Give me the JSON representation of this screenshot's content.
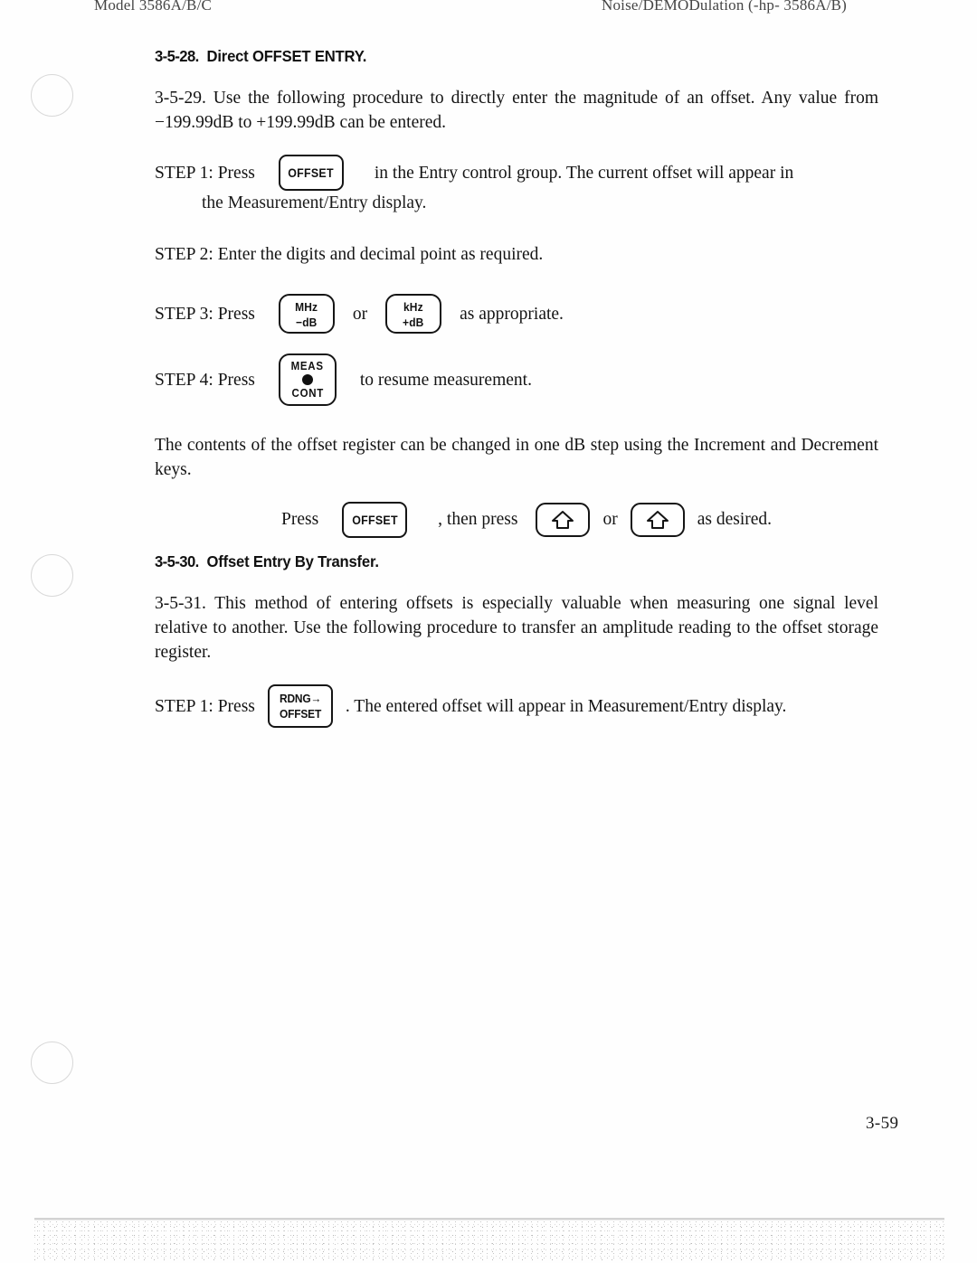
{
  "header": {
    "left": "Model 3586A/B/C",
    "right": "Noise/DEMODulation (-hp- 3586A/B)"
  },
  "sections": [
    {
      "id": "3-5-28",
      "number": "3-5-28.",
      "title": "Direct OFFSET ENTRY."
    },
    {
      "id": "3-5-30",
      "number": "3-5-30.",
      "title": "Offset Entry By Transfer."
    }
  ],
  "paragraphs": {
    "p_3_5_29": "3-5-29.  Use the following procedure to directly enter the magnitude of an offset. Any value from −199.99dB to +199.99dB can be entered.",
    "p_offset_register": "The contents of the offset register can be changed in one dB step using the Increment and Decrement keys.",
    "p_3_5_31": "3-5-31.  This method of entering offsets is especially valuable when measuring one signal level relative to another. Use the following procedure to transfer an amplitude reading to the offset storage register."
  },
  "steps": {
    "step1a": {
      "lead": "STEP 1:  Press",
      "tail": "in the Entry control group. The current offset will appear in",
      "sub": "the Measurement/Entry display."
    },
    "step2": {
      "text": "STEP 2:  Enter the digits and decimal point as required."
    },
    "step3": {
      "lead": "STEP 3:  Press",
      "mid": "or",
      "tail": "as appropriate."
    },
    "step4": {
      "lead": "STEP 4:  Press",
      "tail": "to resume measurement."
    },
    "press_line": {
      "lead": "Press",
      "mid_after_offset": ", then press",
      "mid_or": "or",
      "tail": "as desired."
    },
    "step1b": {
      "lead": "STEP 1:  Press",
      "tail": ". The entered offset will appear in Measurement/Entry display."
    }
  },
  "keys": {
    "offset": {
      "label": "OFFSET",
      "name": "offset-key"
    },
    "mhz_minus_db": {
      "line1": "MHz",
      "line2": "−dB",
      "name": "mhz-minus-db-key"
    },
    "khz_plus_db": {
      "line1": "kHz",
      "line2": "+dB",
      "name": "khz-plus-db-key"
    },
    "meas_cont": {
      "line1": "MEAS",
      "line2": "CONT",
      "name": "meas-cont-key"
    },
    "increment": {
      "glyph": "up-arrow",
      "name": "increment-key"
    },
    "decrement": {
      "glyph": "up-arrow",
      "name": "decrement-key"
    },
    "rdng_offset": {
      "line1": "RDNG→",
      "line2": "OFFSET",
      "name": "rdng-to-offset-key"
    }
  },
  "footer": {
    "page_number": "3-59"
  },
  "colors": {
    "ink": "#141414",
    "paper": "#fefefe",
    "key_outline": "#151515",
    "hole_outline": "#d8d8d8"
  }
}
